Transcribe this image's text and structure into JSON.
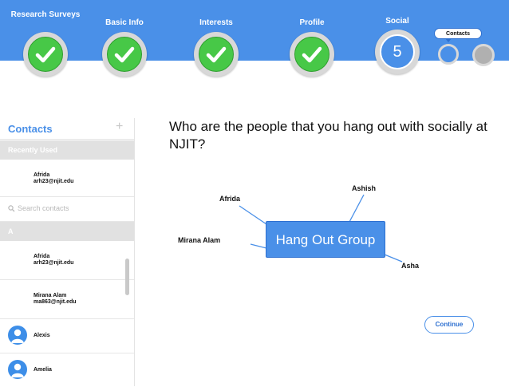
{
  "progress": {
    "steps": [
      {
        "label": "Research Surveys",
        "status": "done"
      },
      {
        "label": "Basic Info",
        "status": "done"
      },
      {
        "label": "Interests",
        "status": "done"
      },
      {
        "label": "Profile",
        "status": "done"
      },
      {
        "label": "Social",
        "status": "current",
        "number": "5"
      }
    ],
    "tooltip": "Contacts"
  },
  "sidebar": {
    "title": "Contacts",
    "add_icon": "plus-icon",
    "recently_used_header": "Recently Used",
    "recent_contacts": [
      {
        "name": "Afrida",
        "email": "arh23@njit.edu"
      }
    ],
    "search": {
      "placeholder": "Search contacts",
      "icon": "search-icon"
    },
    "letter_header": "A",
    "contacts": [
      {
        "name": "Afrida",
        "email": "arh23@njit.edu"
      },
      {
        "name": "Mirana Alam",
        "email": "ma863@njit.edu"
      }
    ],
    "avatar_contacts": [
      {
        "name": "Alexis"
      },
      {
        "name": "Amelia"
      }
    ]
  },
  "main": {
    "question": "Who are the people that you hang out with socially at NJIT?",
    "group_label": "Hang Out Group",
    "people": [
      "Afrida",
      "Ashish",
      "Mirana Alam",
      "Asha"
    ],
    "continue_label": "Continue"
  },
  "colors": {
    "header": "#4a90e8",
    "complete": "#47c847",
    "accent": "#4a90e8"
  }
}
